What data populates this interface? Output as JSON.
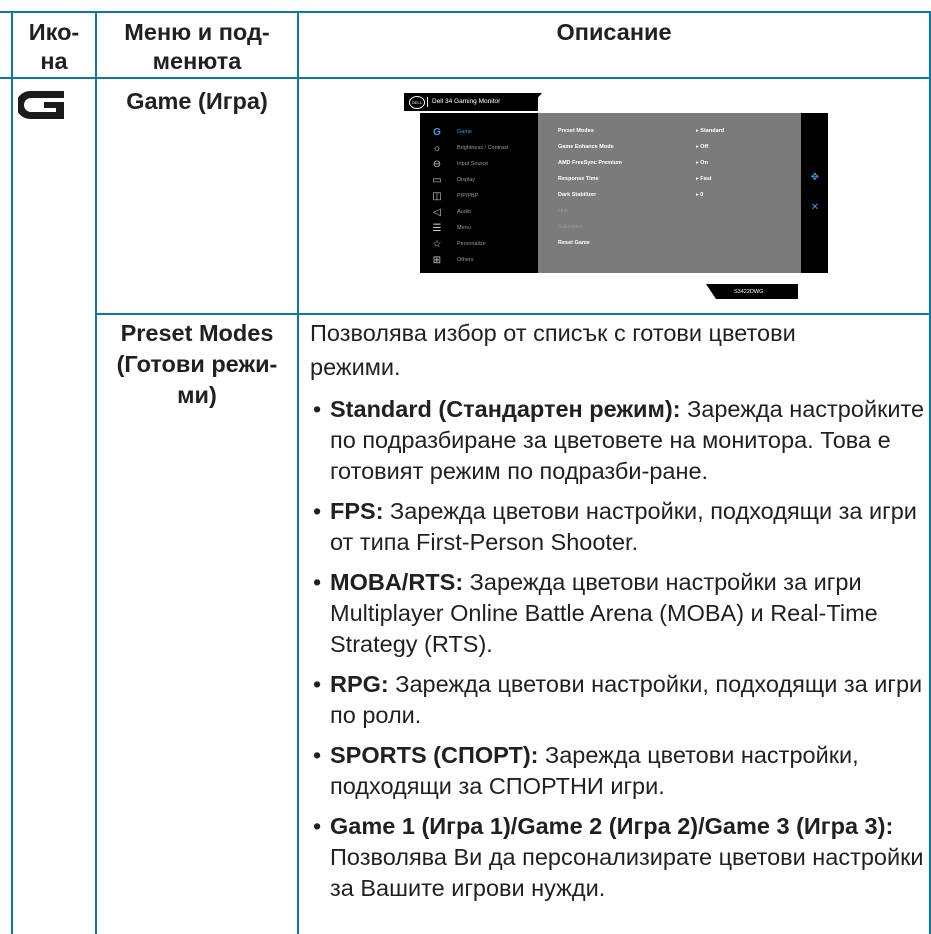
{
  "header": {
    "icon_col_line1": "Ико-",
    "icon_col_line2": "на",
    "menu_col_line1": "Меню и под-",
    "menu_col_line2": "менюта",
    "desc_col": "Описание"
  },
  "game_row": {
    "icon": "game-g-icon",
    "menu_label": "Game (Игра)",
    "osd": {
      "logo": "DELL",
      "model_title": "Dell 34 Gaming Monitor",
      "menu_items": [
        {
          "icon": "game-icon",
          "label": "Game",
          "active": true
        },
        {
          "icon": "brightness-icon",
          "label": "Brightness / Contrast",
          "active": false
        },
        {
          "icon": "input-source-icon",
          "label": "Input Source",
          "active": false
        },
        {
          "icon": "display-icon",
          "label": "Display",
          "active": false
        },
        {
          "icon": "pip-pbp-icon",
          "label": "PIP/PBP",
          "active": false
        },
        {
          "icon": "audio-icon",
          "label": "Audio",
          "active": false
        },
        {
          "icon": "menu-icon",
          "label": "Menu",
          "active": false
        },
        {
          "icon": "star-icon",
          "label": "Personalize",
          "active": false
        },
        {
          "icon": "others-icon",
          "label": "Others",
          "active": false
        }
      ],
      "settings": [
        {
          "name": "Preset Modes",
          "value": "Standard",
          "dim": false
        },
        {
          "name": "Game Enhance Mode",
          "value": "Off",
          "dim": false
        },
        {
          "name": "AMD FreeSync Premium",
          "value": "On",
          "dim": false
        },
        {
          "name": "Response Time",
          "value": "Fast",
          "dim": false
        },
        {
          "name": "Dark Stabilizer",
          "value": "0",
          "dim": false
        },
        {
          "name": "Hue",
          "value": "",
          "dim": true
        },
        {
          "name": "Saturation",
          "value": "",
          "dim": true
        },
        {
          "name": "Reset Game",
          "value": "",
          "dim": false
        }
      ],
      "model_number": "S3422DWG"
    }
  },
  "preset_row": {
    "menu_label_line1": "Preset Modes",
    "menu_label_line2": "(Готови режи-",
    "menu_label_line3": "ми)",
    "intro_line1": "Позволява избор от списък с готови цветови",
    "intro_line2": "режими.",
    "bullets": [
      {
        "term": "Standard (Стандартен режим):",
        "text": " Зарежда настройките по подразбиране за цветовете на монитора. Това е готовият режим по подразби-ране."
      },
      {
        "term": "FPS:",
        "text": " Зарежда цветови настройки, подходящи за игри от типа First-Person Shooter."
      },
      {
        "term": "MOBA/RTS:",
        "text": " Зарежда цветови настройки за игри Multiplayer Online Battle Arena (MOBA) и Real-Time Strategy (RTS)."
      },
      {
        "term": "RPG:",
        "text": " Зарежда цветови настройки, подходящи за игри по роли."
      },
      {
        "term": "SPORTS (СПОРТ):",
        "text": " Зарежда цветови настройки, подходящи за СПОРТНИ игри."
      },
      {
        "term": "Game 1 (Игра 1)/Game 2 (Игра 2)/Game 3 (Игра 3):",
        "text": " Позволява Ви да персонализирате цветови настройки за Вашите игрови нужди."
      }
    ]
  },
  "colors": {
    "border": "#0e76a8",
    "osd_accent": "#2fa3e6",
    "osd_panel": "#7b7b7b"
  }
}
